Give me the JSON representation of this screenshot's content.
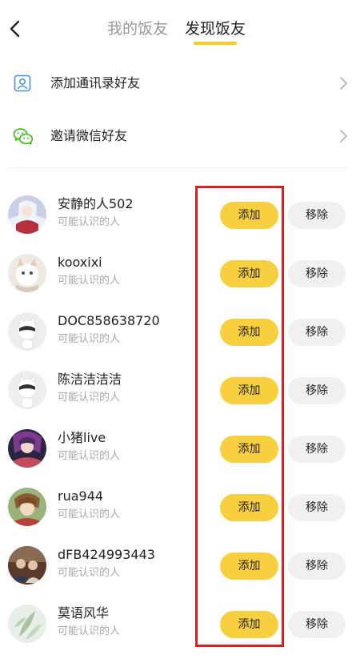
{
  "header": {
    "tabs": [
      {
        "label": "我的饭友",
        "active": false
      },
      {
        "label": "发现饭友",
        "active": true
      }
    ]
  },
  "menu": {
    "contacts_label": "添加通讯录好友",
    "wechat_label": "邀请微信好友"
  },
  "friends": [
    {
      "name": "安静的人502",
      "subtitle": "可能认识的人",
      "add_label": "添加",
      "remove_label": "移除"
    },
    {
      "name": "kooxixi",
      "subtitle": "可能认识的人",
      "add_label": "添加",
      "remove_label": "移除"
    },
    {
      "name": "DOC858638720",
      "subtitle": "可能认识的人",
      "add_label": "添加",
      "remove_label": "移除"
    },
    {
      "name": "陈洁洁洁洁",
      "subtitle": "可能认识的人",
      "add_label": "添加",
      "remove_label": "移除"
    },
    {
      "name": "小猪live",
      "subtitle": "可能认识的人",
      "add_label": "添加",
      "remove_label": "移除"
    },
    {
      "name": "rua944",
      "subtitle": "可能认识的人",
      "add_label": "添加",
      "remove_label": "移除"
    },
    {
      "name": "dFB424993443",
      "subtitle": "可能认识的人",
      "add_label": "添加",
      "remove_label": "移除"
    },
    {
      "name": "莫语风华",
      "subtitle": "可能认识的人",
      "add_label": "添加",
      "remove_label": "移除"
    }
  ],
  "colors": {
    "accent_yellow": "#f8cf3f",
    "tab_underline": "#f5cb2c",
    "annotation_red": "#d42227",
    "icon_blue": "#4a90e2",
    "icon_green": "#2dc100"
  },
  "icons": {
    "back": "chevron-left-icon",
    "contacts": "contact-card-icon",
    "wechat": "wechat-icon",
    "row_arrow": "chevron-right-icon"
  }
}
